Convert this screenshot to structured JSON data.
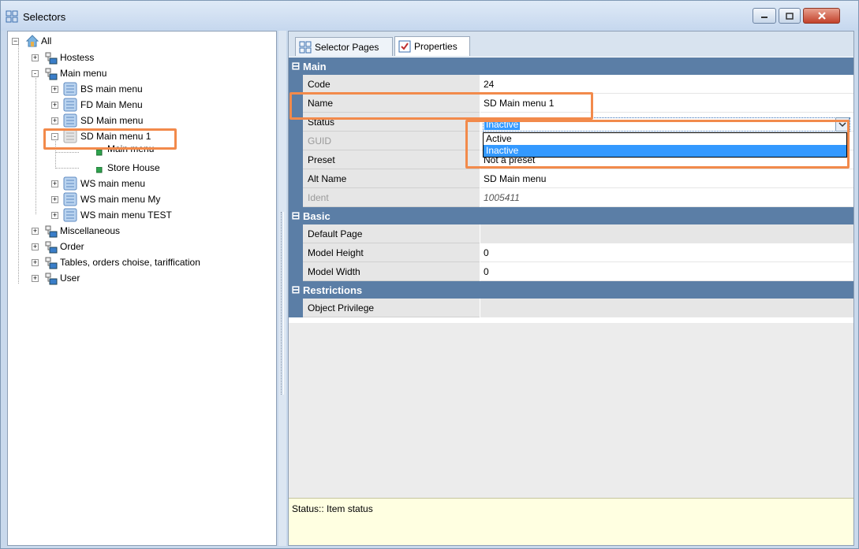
{
  "window": {
    "title": "Selectors",
    "icon": "selectors-icon",
    "controls": [
      "minimize-icon",
      "maximize-icon",
      "close-icon"
    ]
  },
  "tree": {
    "root": "All",
    "nodes": [
      {
        "label": "Hostess",
        "icon": "folder-icon",
        "expander": "+"
      },
      {
        "label": "Main menu",
        "icon": "folder-icon",
        "expander": "-"
      },
      {
        "label": "BS main menu",
        "icon": "menu-folder-icon",
        "expander": "+"
      },
      {
        "label": "FD Main Menu",
        "icon": "menu-folder-icon",
        "expander": "+"
      },
      {
        "label": "SD Main menu",
        "icon": "menu-folder-icon",
        "expander": "+"
      },
      {
        "label": "SD Main menu 1",
        "icon": "menu-folder-icon",
        "expander": "-"
      },
      {
        "label": "Main menu",
        "icon": "leaf-icon"
      },
      {
        "label": "Store House",
        "icon": "leaf-icon"
      },
      {
        "label": "WS main menu",
        "icon": "menu-folder-icon",
        "expander": "+"
      },
      {
        "label": "WS main menu My",
        "icon": "menu-folder-icon",
        "expander": "+"
      },
      {
        "label": "WS main menu TEST",
        "icon": "menu-folder-icon",
        "expander": "+"
      },
      {
        "label": "Miscellaneous",
        "icon": "folder-icon",
        "expander": "+"
      },
      {
        "label": "Order",
        "icon": "folder-icon",
        "expander": "+"
      },
      {
        "label": "Tables, orders choise, tariffication",
        "icon": "folder-icon",
        "expander": "+"
      },
      {
        "label": "User",
        "icon": "folder-icon",
        "expander": "+"
      }
    ]
  },
  "tabs": [
    {
      "label": "Selector Pages",
      "icon": "selector-pages-icon"
    },
    {
      "label": "Properties",
      "icon": "properties-icon"
    }
  ],
  "grid": {
    "categories": {
      "main": "Main",
      "basic": "Basic",
      "restrictions": "Restrictions"
    },
    "main_rows": [
      {
        "name": "Code",
        "value": "24"
      },
      {
        "name": "Name",
        "value": "SD Main menu 1"
      },
      {
        "name": "Status",
        "value": "Inactive"
      },
      {
        "name": "GUID",
        "value": ""
      },
      {
        "name": "Preset",
        "value": "Not a preset"
      },
      {
        "name": "Alt Name",
        "value": "SD Main menu"
      },
      {
        "name": "Ident",
        "value": "1005411"
      }
    ],
    "basic_rows": [
      {
        "name": "Default Page",
        "value": ""
      },
      {
        "name": "Model Height",
        "value": "0"
      },
      {
        "name": "Model Width",
        "value": "0"
      }
    ],
    "restrictions_rows": [
      {
        "name": "Object Privilege",
        "value": ""
      }
    ]
  },
  "status_dropdown": {
    "current": "Inactive",
    "options": [
      "Active",
      "Inactive"
    ],
    "selected": "Inactive"
  },
  "help_text": "Status:: Item status",
  "colors": {
    "highlight": "#f28a4b",
    "category": "#5b7ea6",
    "selection": "#3399ff"
  }
}
